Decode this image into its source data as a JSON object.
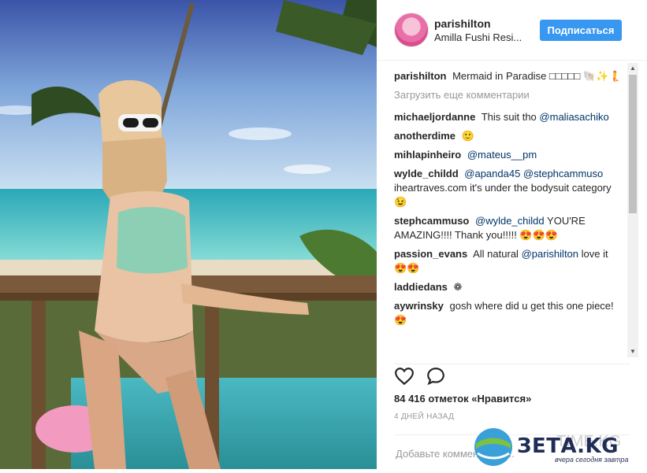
{
  "post": {
    "username": "parishilton",
    "location": "Amilla Fushi Resi...",
    "follow_label": "Подписаться"
  },
  "caption": {
    "user": "parishilton",
    "text": "Mermaid in Paradise □□□□□ 🐚✨🧜"
  },
  "load_more": "Загрузить еще комментарии",
  "comments": [
    {
      "user": "michaeljordanne",
      "text": "This suit tho",
      "mention": "@maliasachiko",
      "after": ""
    },
    {
      "user": "anotherdime",
      "text": "🙂",
      "mention": "",
      "after": ""
    },
    {
      "user": "mihlapinheiro",
      "text": "",
      "mention": "@mateus__pm",
      "after": ""
    },
    {
      "user": "wylde_childd",
      "text": "",
      "mention": "@apanda45 @stephcammuso",
      "after": "iheartraves.com it's under the bodysuit category 😉"
    },
    {
      "user": "stephcammuso",
      "text": "",
      "mention": "@wylde_childd",
      "after": "YOU'RE AMAZING!!!! Thank you!!!!! 😍😍😍"
    },
    {
      "user": "passion_evans",
      "text": "All natural",
      "mention": "@parishilton",
      "after": "love it 😍😍"
    },
    {
      "user": "laddiedans",
      "text": "❁",
      "mention": "",
      "after": ""
    },
    {
      "user": "aywrinsky",
      "text": "gosh where did u get this one piece! 😍",
      "mention": "",
      "after": ""
    }
  ],
  "likes": "84 416 отметок «Нравится»",
  "time": "4 ДНЕЙ НАЗАД",
  "comment_placeholder": "Добавьте комментарий...",
  "watermark": {
    "brand": "ЗЕТА.KG",
    "tagline": "вчера сегодня завтра",
    "ghost": "TIME.KG"
  },
  "icons": [
    "heart-icon",
    "comment-icon",
    "scroll-up-arrow",
    "scroll-down-arrow",
    "globe-logo"
  ]
}
